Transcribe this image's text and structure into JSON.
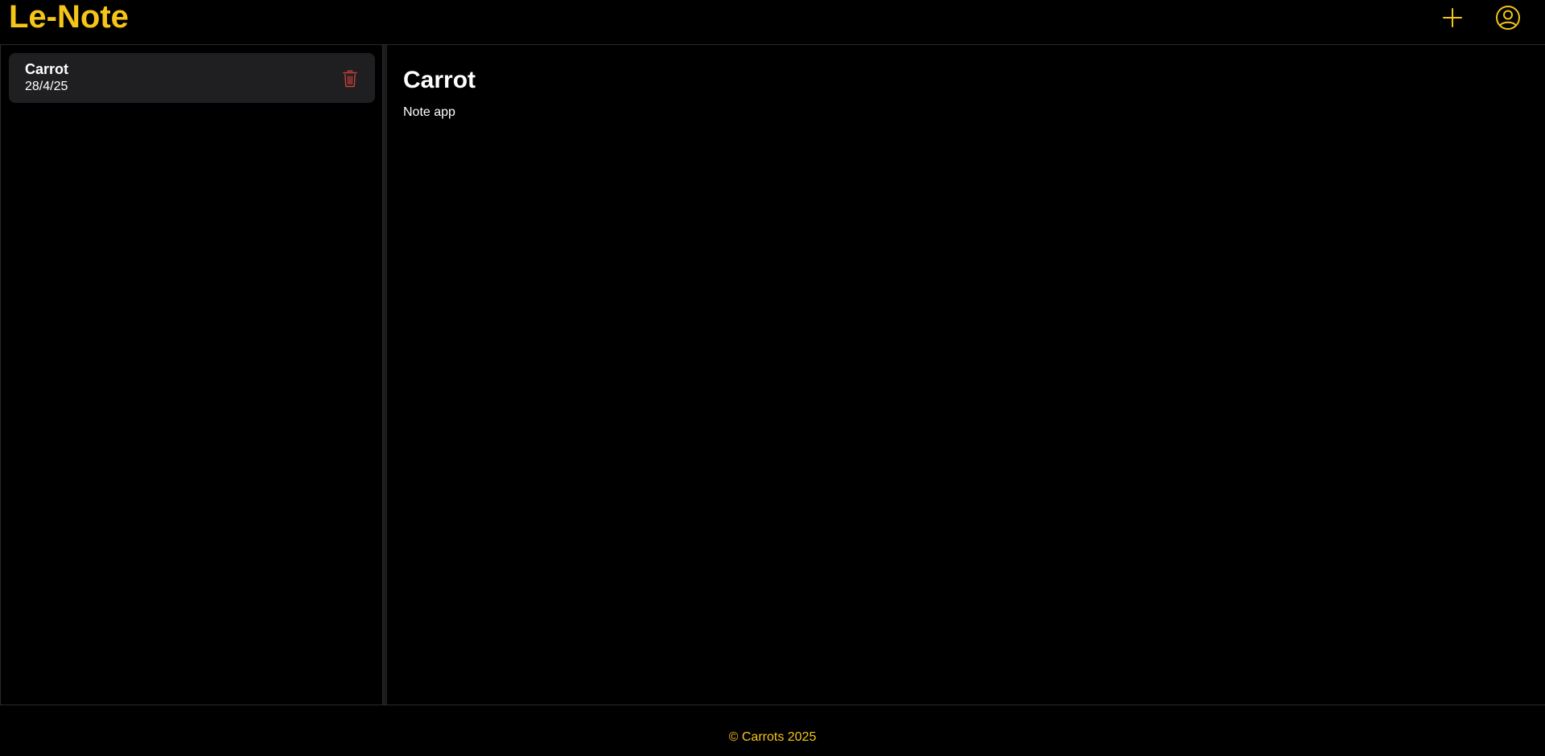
{
  "app": {
    "title": "Le-Note",
    "accent_color": "#f5c518",
    "danger_color": "#c9403a"
  },
  "header": {
    "add_icon": "plus-icon",
    "profile_icon": "user-circle-icon"
  },
  "sidebar": {
    "notes": [
      {
        "title": "Carrot",
        "date": "28/4/25",
        "delete_icon": "trash-icon"
      }
    ]
  },
  "main": {
    "note_title": "Carrot",
    "note_body": "Note app"
  },
  "footer": {
    "text": "© Carrots 2025"
  }
}
